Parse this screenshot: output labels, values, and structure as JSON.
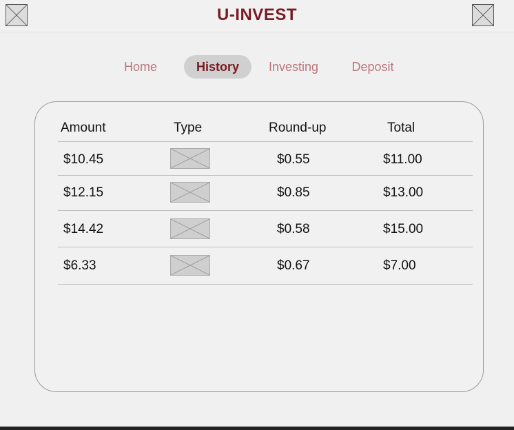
{
  "header": {
    "title": "U-INVEST",
    "left_icon": "image-placeholder-icon",
    "right_icon": "image-placeholder-icon"
  },
  "nav": {
    "items": [
      {
        "label": "Home"
      },
      {
        "label": "History"
      },
      {
        "label": "Investing"
      },
      {
        "label": "Deposit"
      }
    ],
    "active": "History"
  },
  "table": {
    "columns": [
      "Amount",
      "Type",
      "Round-up",
      "Total"
    ],
    "rows": [
      {
        "amount": "$10.45",
        "type_icon": "image-placeholder-icon",
        "roundup": "$0.55",
        "total": "$11.00"
      },
      {
        "amount": "$12.15",
        "type_icon": "image-placeholder-icon",
        "roundup": "$0.85",
        "total": "$13.00"
      },
      {
        "amount": "$14.42",
        "type_icon": "image-placeholder-icon",
        "roundup": "$0.58",
        "total": "$15.00"
      },
      {
        "amount": "$6.33",
        "type_icon": "image-placeholder-icon",
        "roundup": "$0.67",
        "total": "$7.00"
      }
    ]
  },
  "colors": {
    "brand": "#7a1a22",
    "nav_inactive": "#b9777d",
    "active_pill": "#d0d0d0",
    "background": "#f0f0f0"
  }
}
